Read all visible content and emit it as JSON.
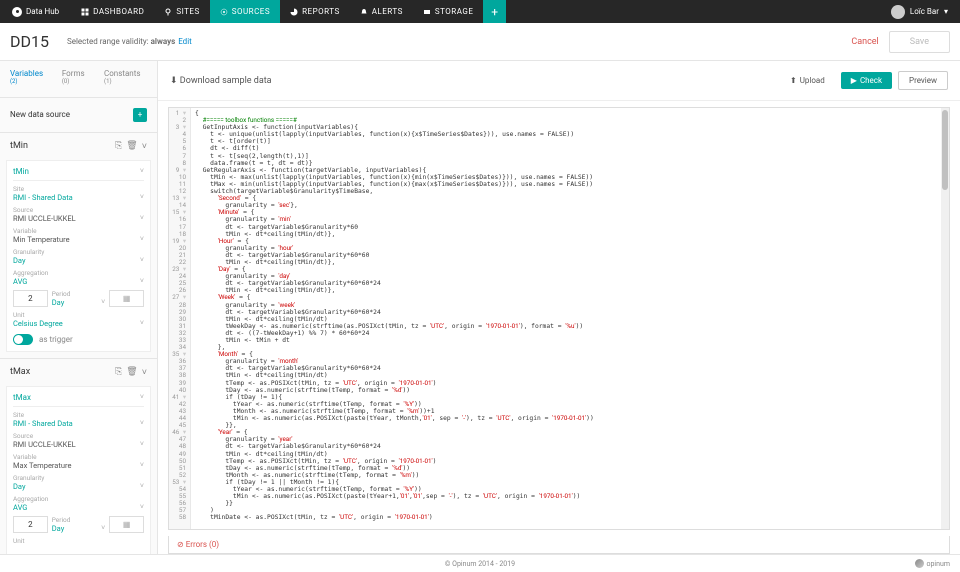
{
  "brand": "Data Hub",
  "nav": {
    "dashboard": "DASHBOARD",
    "sites": "SITES",
    "sources": "SOURCES",
    "reports": "REPORTS",
    "alerts": "ALERTS",
    "storage": "STORAGE"
  },
  "user": {
    "name": "Loïc Bar"
  },
  "page": {
    "title": "DD15",
    "validity_label": "Selected range validity:",
    "validity_value": "always",
    "edit": "Edit",
    "cancel": "Cancel",
    "save": "Save"
  },
  "tabs": {
    "variables": "Variables",
    "variables_count": "(2)",
    "forms": "Forms",
    "forms_count": "(0)",
    "constants": "Constants",
    "constants_count": "(1)"
  },
  "new_source": "New data source",
  "vars": [
    {
      "header": "tMin",
      "title": "tMin",
      "site_label": "Site",
      "site": "RMI - Shared Data",
      "source_label": "Source",
      "source": "RMI UCCLE-UKKEL",
      "variable_label": "Variable",
      "variable": "Min Temperature",
      "gran_label": "Granularity",
      "gran": "Day",
      "agg_label": "Aggregation",
      "agg": "AVG",
      "num": "2",
      "period_label": "Period",
      "period": "Day",
      "unit_label": "Unit",
      "unit": "Celsius Degree",
      "trigger": "as trigger"
    },
    {
      "header": "tMax",
      "title": "tMax",
      "site_label": "Site",
      "site": "RMI - Shared Data",
      "source_label": "Source",
      "source": "RMI UCCLE-UKKEL",
      "variable_label": "Variable",
      "variable": "Max Temperature",
      "gran_label": "Granularity",
      "gran": "Day",
      "agg_label": "Aggregation",
      "agg": "AVG",
      "num": "2",
      "period_label": "Period",
      "period": "Day",
      "unit_label": "Unit"
    }
  ],
  "content_head": {
    "download": "Download sample data",
    "upload": "Upload",
    "check": "Check",
    "preview": "Preview"
  },
  "errors": "Errors (0)",
  "footer": "© Opinum 2014 - 2019",
  "footer_brand": "opinum",
  "code": [
    "{",
    "  #===== toolbox functions =====#",
    "  GetInputAxis <- function(inputVariables){",
    "    t <- unique(unlist(lapply(inputVariables, function(x){x$TimeSeries$Dates})), use.names = FALSE))",
    "    t <- t[order(t)]",
    "    dt <- diff(t)",
    "    t <- t[seq(2,length(t),1)]",
    "    data.frame(t = t, dt = dt)}",
    "  GetRegularAxis <- function(targetVariable, inputVariables){",
    "    tMin <- max(unlist(lapply(inputVariables, function(x){min(x$TimeSeries$Dates)})), use.names = FALSE))",
    "    tMax <- min(unlist(lapply(inputVariables, function(x){max(x$TimeSeries$Dates)})), use.names = FALSE))",
    "    switch(targetVariable$Granularity$TimeBase,",
    "      'Second' = {",
    "        granularity = 'sec'},",
    "      'Minute' = {",
    "        granularity = 'min'",
    "        dt <- targetVariable$Granularity*60",
    "        tMin <- dt*ceiling(tMin/dt)},",
    "      'Hour' = {",
    "        granularity = 'hour'",
    "        dt <- targetVariable$Granularity*60*60",
    "        tMin <- dt*ceiling(tMin/dt)},",
    "      'Day' = {",
    "        granularity = 'day'",
    "        dt <- targetVariable$Granularity*60*60*24",
    "        tMin <- dt*ceiling(tMin/dt)},",
    "      'Week' = {",
    "        granularity = 'week'",
    "        dt <- targetVariable$Granularity*60*60*24",
    "        tMin <- dt*ceiling(tMin/dt)",
    "        tWeekDay <- as.numeric(strftime(as.POSIXct(tMin, tz = 'UTC', origin = '1970-01-01'), format = '%u'))",
    "        dt <- ((7-tWeekDay+1) %% 7) * 60*60*24",
    "        tMin <- tMin + dt",
    "      },",
    "      'Month' = {",
    "        granularity = 'month'",
    "        dt <- targetVariable$Granularity*60*60*24",
    "        tMin <- dt*ceiling(tMin/dt)",
    "        tTemp <- as.POSIXct(tMin, tz = 'UTC', origin = '1970-01-01')",
    "        tDay <- as.numeric(strftime(tTemp, format = '%d'))",
    "        if (tDay != 1){",
    "          tYear <- as.numeric(strftime(tTemp, format = '%Y'))",
    "          tMonth <- as.numeric(strftime(tTemp, format = '%m'))+1",
    "          tMin <- as.numeric(as.POSIXct(paste(tYear, tMonth,'01', sep = '-'), tz = 'UTC', origin = '1970-01-01'))",
    "        }},",
    "      'Year' = {",
    "        granularity = 'year'",
    "        dt <- targetVariable$Granularity*60*60*24",
    "        tMin <- dt*ceiling(tMin/dt)",
    "        tTemp <- as.POSIXct(tMin, tz = 'UTC', origin = '1970-01-01')",
    "        tDay <- as.numeric(strftime(tTemp, format = '%d'))",
    "        tMonth <- as.numeric(strftime(tTemp, format = '%m'))",
    "        if (tDay != 1 || tMonth != 1){",
    "          tYear <- as.numeric(strftime(tTemp, format = '%Y'))",
    "          tMin <- as.numeric(as.POSIXct(paste(tYear+1,'01','01',sep = '-'), tz = 'UTC', origin = '1970-01-01'))",
    "        }}",
    "    )",
    "    tMinDate <- as.POSIXct(tMin, tz = 'UTC', origin = '1970-01-01')"
  ]
}
